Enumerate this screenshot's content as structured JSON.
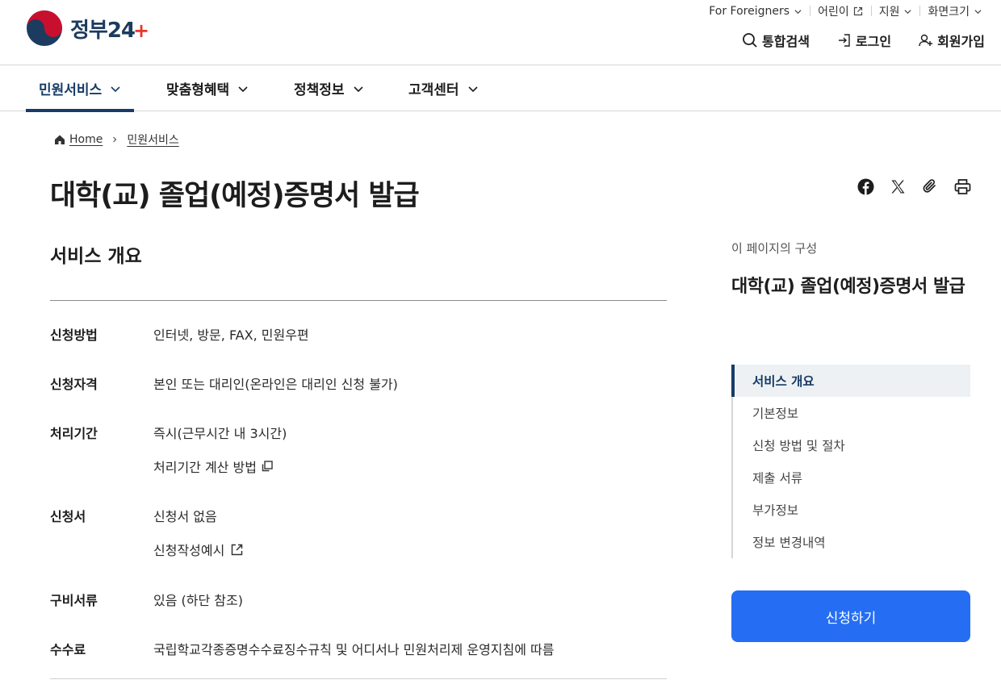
{
  "header": {
    "logo_text": "정부",
    "logo_num": "24",
    "logo_plus": "+",
    "utility": [
      {
        "label": "For Foreigners"
      },
      {
        "label": "어린이"
      },
      {
        "label": "지원"
      },
      {
        "label": "화면크기"
      }
    ],
    "actions": {
      "search": "통합검색",
      "login": "로그인",
      "signup": "회원가입"
    }
  },
  "gnb": {
    "items": [
      {
        "label": "민원서비스",
        "active": true
      },
      {
        "label": "맞춤형혜택",
        "active": false
      },
      {
        "label": "정책정보",
        "active": false
      },
      {
        "label": "고객센터",
        "active": false
      }
    ]
  },
  "breadcrumb": {
    "home": "Home",
    "current": "민원서비스"
  },
  "page": {
    "title": "대학(교) 졸업(예정)증명서 발급",
    "section_title": "서비스 개요"
  },
  "info": {
    "method": {
      "label": "신청방법",
      "value": "인터넷, 방문, FAX, 민원우편"
    },
    "eligibility": {
      "label": "신청자격",
      "value": "본인 또는 대리인(온라인은 대리인 신청 불가)"
    },
    "period": {
      "label": "처리기간",
      "value": "즉시(근무시간 내 3시간)",
      "link": "처리기간 계산 방법"
    },
    "form": {
      "label": "신청서",
      "value": "신청서 없음",
      "link": "신청작성예시"
    },
    "documents": {
      "label": "구비서류",
      "value": "있음 (하단 참조)"
    },
    "fee": {
      "label": "수수료",
      "value": "국립학교각종증명수수료징수규칙 및 어디서나 민원처리제 운영지침에 따름"
    }
  },
  "toc": {
    "caption": "이 페이지의 구성",
    "title": "대학(교) 졸업(예정)증명서 발급",
    "items": [
      "서비스 개요",
      "기본정보",
      "신청 방법 및 절차",
      "제출 서류",
      "부가정보",
      "정보 변경내역"
    ]
  },
  "apply_button": "신청하기",
  "colors": {
    "brand_navy": "#163c67",
    "apply_blue": "#256ef4",
    "logo_red": "#e2382c"
  }
}
